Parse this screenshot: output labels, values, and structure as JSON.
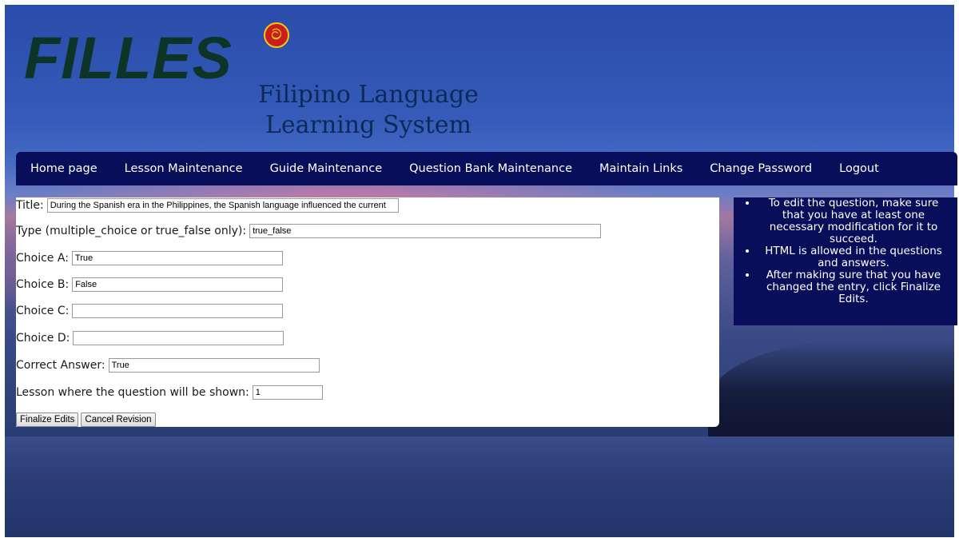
{
  "logo": {
    "title": "FILLES",
    "badge_icon": "red-seal-icon",
    "subtitle_line1": "Filipino Language",
    "subtitle_line2": "Learning System"
  },
  "nav": {
    "items": [
      "Home page",
      "Lesson Maintenance",
      "Guide Maintenance",
      "Question Bank Maintenance",
      "Maintain Links",
      "Change Password",
      "Logout"
    ]
  },
  "form": {
    "title": {
      "label": "Title:",
      "value": "During the Spanish era in the Philippines, the Spanish language influenced the current"
    },
    "type": {
      "label": "Type (multiple_choice or true_false only):",
      "value": "true_false"
    },
    "choice_a": {
      "label": "Choice A:",
      "value": "True"
    },
    "choice_b": {
      "label": "Choice B:",
      "value": "False"
    },
    "choice_c": {
      "label": "Choice C:",
      "value": ""
    },
    "choice_d": {
      "label": "Choice D:",
      "value": ""
    },
    "correct_answer": {
      "label": "Correct Answer:",
      "value": "True"
    },
    "lesson": {
      "label": "Lesson where the question will be shown:",
      "value": "1"
    },
    "finalize_label": "Finalize Edits",
    "cancel_label": "Cancel Revision"
  },
  "help": {
    "items": [
      "To edit the question, make sure that you have at least one necessary modification for it to succeed.",
      "HTML is allowed in the questions and answers.",
      "After making sure that you have changed the entry, click Finalize Edits."
    ]
  },
  "colors": {
    "nav_bg": "#080e5a",
    "logo_green": "#0c3528",
    "subtitle_blue": "#0b2b56"
  }
}
